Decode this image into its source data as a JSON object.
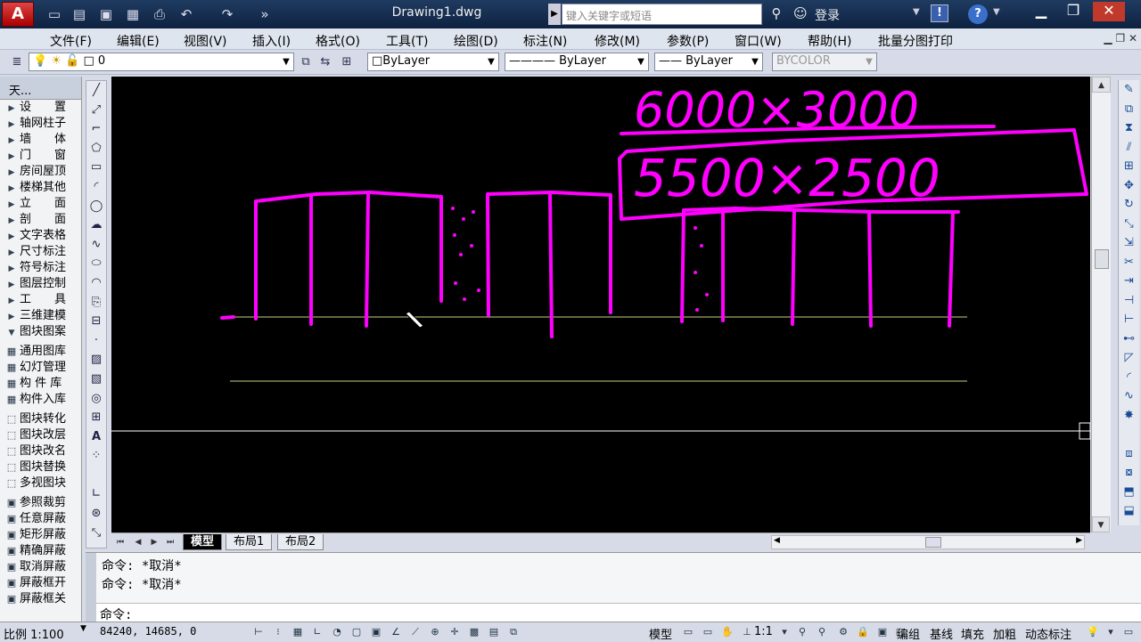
{
  "titlebar": {
    "logo": "A",
    "document_title": "Drawing1.dwg",
    "search_placeholder": "键入关键字或短语",
    "login": "登录",
    "exchange": "!",
    "help": "?"
  },
  "menu": [
    "文件(F)",
    "编辑(E)",
    "视图(V)",
    "插入(I)",
    "格式(O)",
    "工具(T)",
    "绘图(D)",
    "标注(N)",
    "修改(M)",
    "参数(P)",
    "窗口(W)",
    "帮助(H)",
    "批量分图打印"
  ],
  "layer_bar": {
    "current_layer": "0",
    "color": "ByLayer",
    "linetype": "ByLayer",
    "lineweight": "ByLayer",
    "plotstyle": "BYCOLOR"
  },
  "palette": {
    "title": "天...",
    "group1": [
      "设　　置",
      "轴网柱子",
      "墙　　体",
      "门　　窗",
      "房间屋顶",
      "楼梯其他",
      "立　　面",
      "剖　　面",
      "文字表格",
      "尺寸标注",
      "符号标注",
      "图层控制",
      "工　　具",
      "三维建模",
      "图块图案"
    ],
    "group2": [
      "通用图库",
      "幻灯管理",
      "构 件 库",
      "构件入库"
    ],
    "group3": [
      "图块转化",
      "图块改层",
      "图块改名",
      "图块替换",
      "多视图块"
    ],
    "group4": [
      "参照裁剪",
      "任意屏蔽",
      "矩形屏蔽",
      "精确屏蔽",
      "取消屏蔽",
      "屏蔽框开",
      "屏蔽框关"
    ]
  },
  "canvas": {
    "sketch_text_top": "6000×3000",
    "sketch_text_box": "5500×2500"
  },
  "tabs": [
    "模型",
    "布局1",
    "布局2"
  ],
  "command": {
    "history": [
      "命令: *取消*",
      "命令: *取消*"
    ],
    "prompt": "命令:"
  },
  "status": {
    "scale": "比例 1:100",
    "coords": "84240, 14685, 0",
    "model": "模型",
    "annotation_scale": "1:1",
    "toggles": [
      "编组",
      "基线",
      "填充",
      "加粗",
      "动态标注"
    ]
  },
  "colors": {
    "sketch": "#ff00ff",
    "guide_line": "#c8d27a",
    "canvas_bg": "#000000"
  }
}
